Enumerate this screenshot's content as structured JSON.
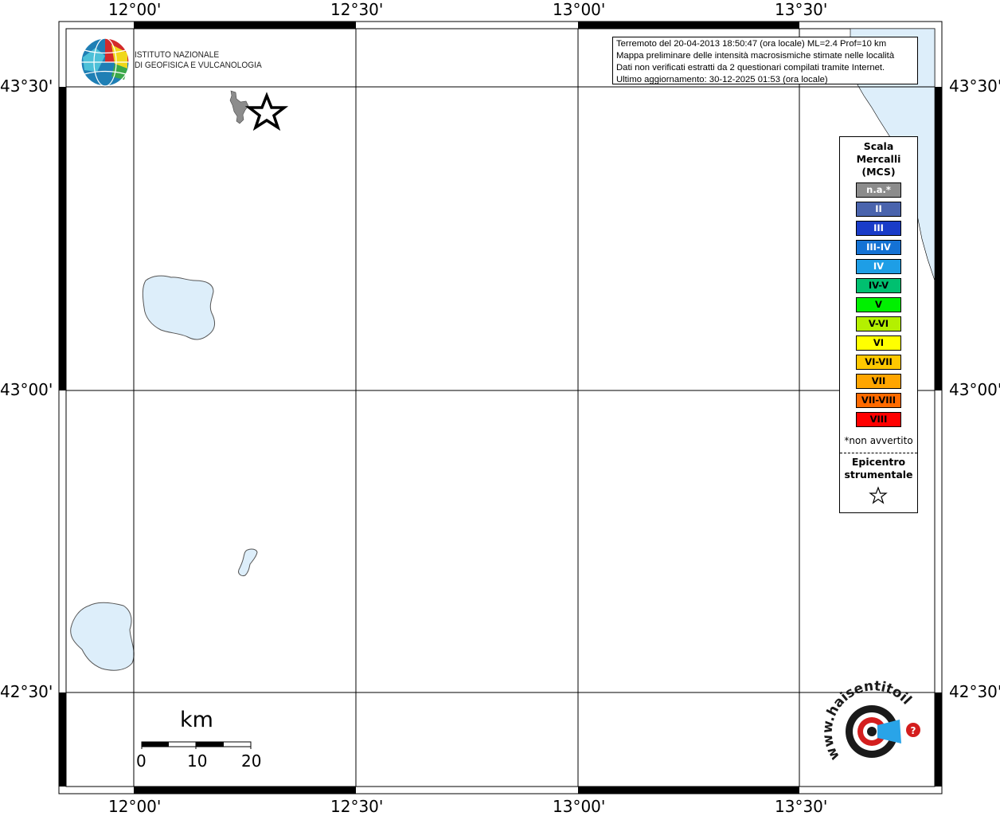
{
  "map": {
    "top_axis_labels": [
      "12°00'",
      "12°30'",
      "13°00'",
      "13°30'"
    ],
    "bottom_axis_labels": [
      "12°00'",
      "12°30'",
      "13°00'",
      "13°30'"
    ],
    "left_axis_labels": [
      "43°30'",
      "43°00'",
      "42°30'"
    ],
    "right_axis_labels": [
      "43°30'",
      "43°00'",
      "42°30'"
    ],
    "sea_color": "#ddeefa",
    "lake_color": "#ddeefa",
    "intensity_area_color": "#8c8c8c"
  },
  "institute": {
    "line1": "ISTITUTO NAZIONALE",
    "line2": "DI GEOFISICA E VULCANOLOGIA"
  },
  "info_box": {
    "line1": "Terremoto del 20-04-2013 18:50:47 (ora locale) ML=2.4 Prof=10 km",
    "line2": "Mappa preliminare delle intensità macrosismiche stimate nelle località",
    "line3": "Dati non verificati estratti da 2 questionari compilati tramite Internet.",
    "line4": "Ultimo aggiornamento: 30-12-2025 01:53 (ora locale)"
  },
  "legend": {
    "title_line1": "Scala",
    "title_line2": "Mercalli",
    "title_line3": "(MCS)",
    "items": [
      {
        "label": "n.a.*",
        "color": "#8c8c8c",
        "text_color": "#ffffff"
      },
      {
        "label": "II",
        "color": "#4a64ad",
        "text_color": "#ffffff"
      },
      {
        "label": "III",
        "color": "#1a3cc8",
        "text_color": "#ffffff"
      },
      {
        "label": "III-IV",
        "color": "#1472d4",
        "text_color": "#ffffff"
      },
      {
        "label": "IV",
        "color": "#1e9ee6",
        "text_color": "#ffffff"
      },
      {
        "label": "IV-V",
        "color": "#00c070",
        "text_color": "#000000"
      },
      {
        "label": "V",
        "color": "#00f000",
        "text_color": "#000000"
      },
      {
        "label": "V-VI",
        "color": "#b4f000",
        "text_color": "#000000"
      },
      {
        "label": "VI",
        "color": "#ffff00",
        "text_color": "#000000"
      },
      {
        "label": "VI-VII",
        "color": "#ffc800",
        "text_color": "#000000"
      },
      {
        "label": "VII",
        "color": "#ffa500",
        "text_color": "#000000"
      },
      {
        "label": "VII-VIII",
        "color": "#ff6a00",
        "text_color": "#000000"
      },
      {
        "label": "VIII",
        "color": "#ff0000",
        "text_color": "#000000"
      }
    ],
    "note": "*non avvertito",
    "epicenter_line1": "Epicentro",
    "epicenter_line2": "strumentale"
  },
  "scale_bar": {
    "unit": "km",
    "ticks": [
      "0",
      "10",
      "20"
    ]
  },
  "watermark": {
    "text": "www.haisentitoilterremoto.it"
  }
}
